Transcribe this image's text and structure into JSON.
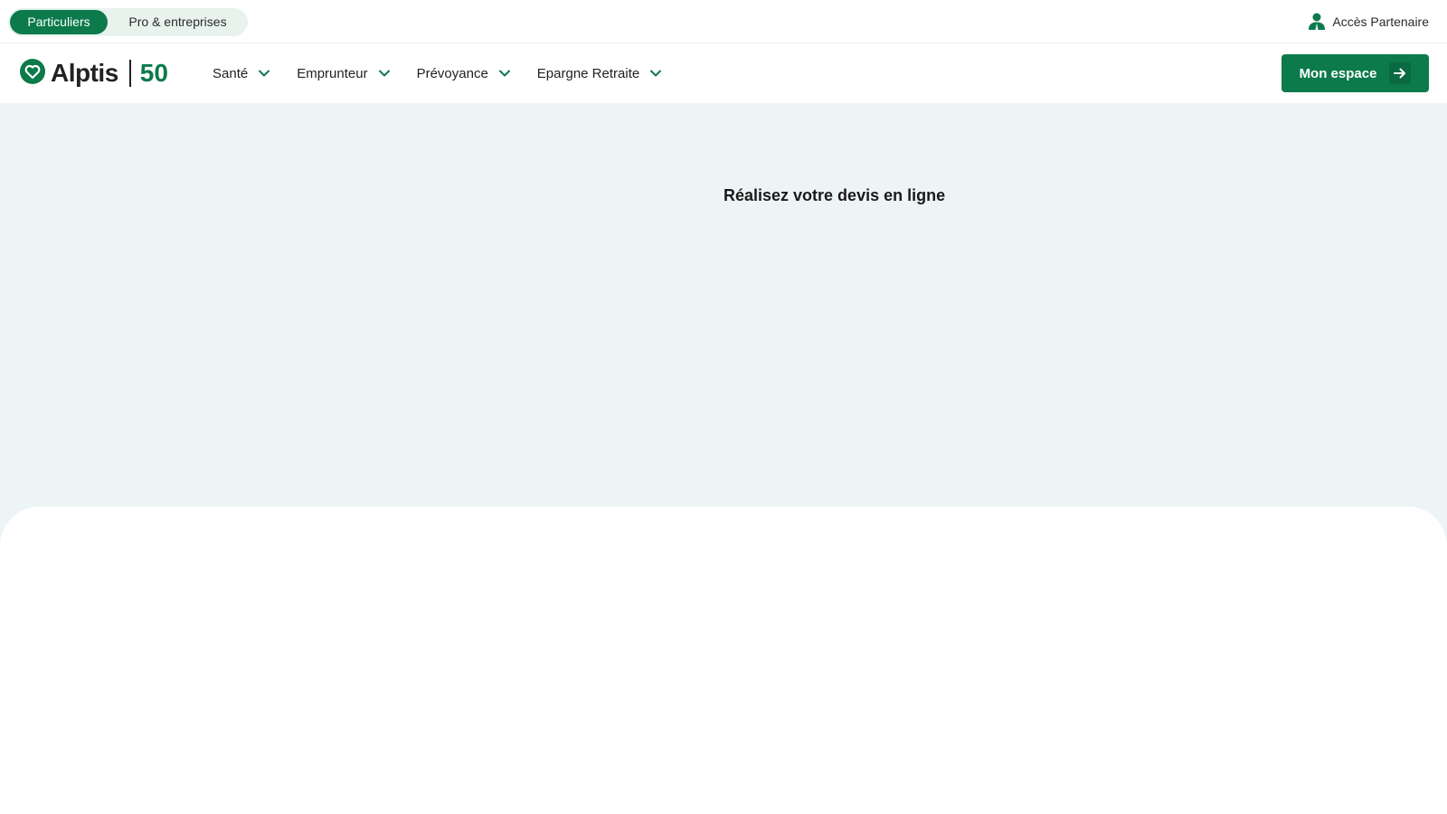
{
  "topbar": {
    "segments": [
      {
        "label": "Particuliers",
        "active": true
      },
      {
        "label": "Pro & entreprises",
        "active": false
      }
    ],
    "partner_label": "Accès Partenaire",
    "partner_icon": "partner-user-icon"
  },
  "brand": {
    "name": "Alptis",
    "badge": "50",
    "logo_icon": "heart-shield-icon",
    "color": "#0c7a4b"
  },
  "nav": {
    "items": [
      {
        "label": "Santé"
      },
      {
        "label": "Emprunteur"
      },
      {
        "label": "Prévoyance"
      },
      {
        "label": "Epargne Retraite"
      }
    ],
    "chevron_icon": "chevron-down-icon"
  },
  "cta": {
    "label": "Mon espace",
    "icon": "arrow-right-icon"
  },
  "hero": {
    "title": "Réalisez votre devis en ligne",
    "background": "#edf4f6"
  }
}
